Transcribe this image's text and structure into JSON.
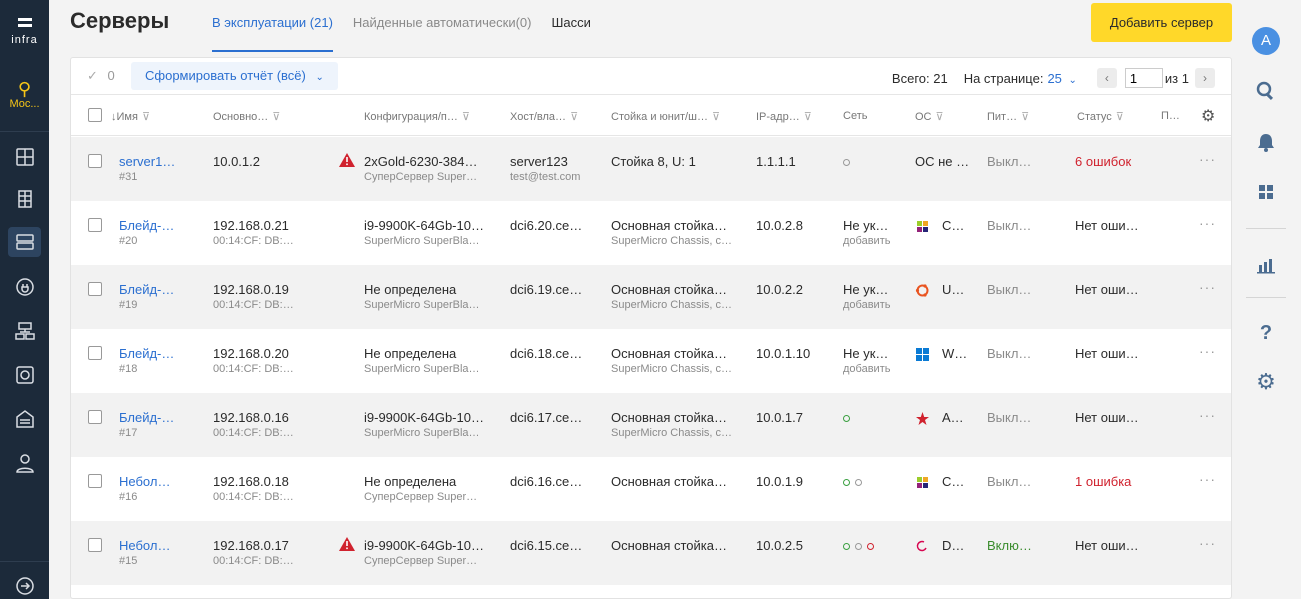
{
  "sidebar": {
    "logo_text": "infra",
    "location": "Мос...",
    "expand_icon": "arrow-right-circle-icon"
  },
  "header": {
    "title": "Серверы",
    "tabs": [
      {
        "label": "В эксплуатации (21)",
        "active": true
      },
      {
        "label": "Найденные автоматически(0)",
        "active": false
      },
      {
        "label": "Шасси",
        "active": false
      }
    ],
    "add_button": "Добавить сервер"
  },
  "toolbar": {
    "selected_count": "0",
    "report_button": "Сформировать отчёт (всё)",
    "total_label": "Всего: 21",
    "per_page_label": "На странице:",
    "per_page_value": "25",
    "page_value": "1",
    "page_of": "из 1"
  },
  "columns": [
    "↓Имя",
    "Основно…",
    "Конфигурация/п…",
    "Хост/вла…",
    "Стойка и юнит/ш…",
    "IP-адр…",
    "Сеть",
    "ОС",
    "Пит…",
    "Статус",
    "П…"
  ],
  "rows": [
    {
      "name": "server1…",
      "id": "#31",
      "ip": "10.0.1.2",
      "ip_sub": "",
      "warn": true,
      "config": "2xGold-6230-384…",
      "config_sub": "СуперСервер Super…",
      "host": "server123",
      "host_sub": "test@test.com",
      "rack": "Стойка 8, U: 1",
      "rack_sub": "",
      "ipmi": "1.1.1.1",
      "net": [
        "grey"
      ],
      "net_text": "",
      "net_sub": "",
      "os_icon": "none",
      "os": "ОС не …",
      "power": "Выкл…",
      "power_class": "grey",
      "status": "6 ошибок",
      "status_class": "red"
    },
    {
      "name": "Блейд-…",
      "id": "#20",
      "ip": "192.168.0.21",
      "ip_sub": "00:14:CF: DB:…",
      "warn": false,
      "config": "i9-9900K-64Gb-10…",
      "config_sub": "SuperMicro SuperBla…",
      "host": "dci6.20.ce…",
      "host_sub": "",
      "rack": "Основная стойка…",
      "rack_sub": "SuperMicro Chassis, c…",
      "ipmi": "10.0.2.8",
      "net": [],
      "net_text": "Не ук…",
      "net_sub": "добавить",
      "os_icon": "centos-icon",
      "os": "C…",
      "power": "Выкл…",
      "power_class": "grey",
      "status": "Нет оши…",
      "status_class": ""
    },
    {
      "name": "Блейд-…",
      "id": "#19",
      "ip": "192.168.0.19",
      "ip_sub": "00:14:CF: DB:…",
      "warn": false,
      "config": "Не определена",
      "config_sub": "SuperMicro SuperBla…",
      "host": "dci6.19.ce…",
      "host_sub": "",
      "rack": "Основная стойка…",
      "rack_sub": "SuperMicro Chassis, c…",
      "ipmi": "10.0.2.2",
      "net": [],
      "net_text": "Не ук…",
      "net_sub": "добавить",
      "os_icon": "ubuntu-icon",
      "os": "U…",
      "power": "Выкл…",
      "power_class": "grey",
      "status": "Нет оши…",
      "status_class": ""
    },
    {
      "name": "Блейд-…",
      "id": "#18",
      "ip": "192.168.0.20",
      "ip_sub": "00:14:CF: DB:…",
      "warn": false,
      "config": "Не определена",
      "config_sub": "SuperMicro SuperBla…",
      "host": "dci6.18.ce…",
      "host_sub": "",
      "rack": "Основная стойка…",
      "rack_sub": "SuperMicro Chassis, c…",
      "ipmi": "10.0.1.10",
      "net": [],
      "net_text": "Не ук…",
      "net_sub": "добавить",
      "os_icon": "windows-icon",
      "os": "W…",
      "power": "Выкл…",
      "power_class": "grey",
      "status": "Нет оши…",
      "status_class": ""
    },
    {
      "name": "Блейд-…",
      "id": "#17",
      "ip": "192.168.0.16",
      "ip_sub": "00:14:CF: DB:…",
      "warn": false,
      "config": "i9-9900K-64Gb-10…",
      "config_sub": "SuperMicro SuperBla…",
      "host": "dci6.17.ce…",
      "host_sub": "",
      "rack": "Основная стойка…",
      "rack_sub": "SuperMicro Chassis, c…",
      "ipmi": "10.0.1.7",
      "net": [
        "g"
      ],
      "net_text": "",
      "net_sub": "",
      "os_icon": "astra-icon",
      "os": "A…",
      "power": "Выкл…",
      "power_class": "grey",
      "status": "Нет оши…",
      "status_class": ""
    },
    {
      "name": "Небол…",
      "id": "#16",
      "ip": "192.168.0.18",
      "ip_sub": "00:14:CF: DB:…",
      "warn": false,
      "config": "Не определена",
      "config_sub": "СуперСервер Super…",
      "host": "dci6.16.ce…",
      "host_sub": "",
      "rack": "Основная стойка…",
      "rack_sub": "",
      "ipmi": "10.0.1.9",
      "net": [
        "g",
        "grey"
      ],
      "net_text": "",
      "net_sub": "",
      "os_icon": "centos-icon",
      "os": "C…",
      "power": "Выкл…",
      "power_class": "grey",
      "status": "1 ошибка",
      "status_class": "red"
    },
    {
      "name": "Небол…",
      "id": "#15",
      "ip": "192.168.0.17",
      "ip_sub": "00:14:CF: DB:…",
      "warn": true,
      "config": "i9-9900K-64Gb-10…",
      "config_sub": "СуперСервер Super…",
      "host": "dci6.15.ce…",
      "host_sub": "",
      "rack": "Основная стойка…",
      "rack_sub": "",
      "ipmi": "10.0.2.5",
      "net": [
        "g",
        "grey",
        "r"
      ],
      "net_text": "",
      "net_sub": "",
      "os_icon": "debian-icon",
      "os": "D…",
      "power": "Вклю…",
      "power_class": "green",
      "status": "Нет оши…",
      "status_class": ""
    }
  ],
  "rightbar": {
    "avatar_letter": "A"
  }
}
